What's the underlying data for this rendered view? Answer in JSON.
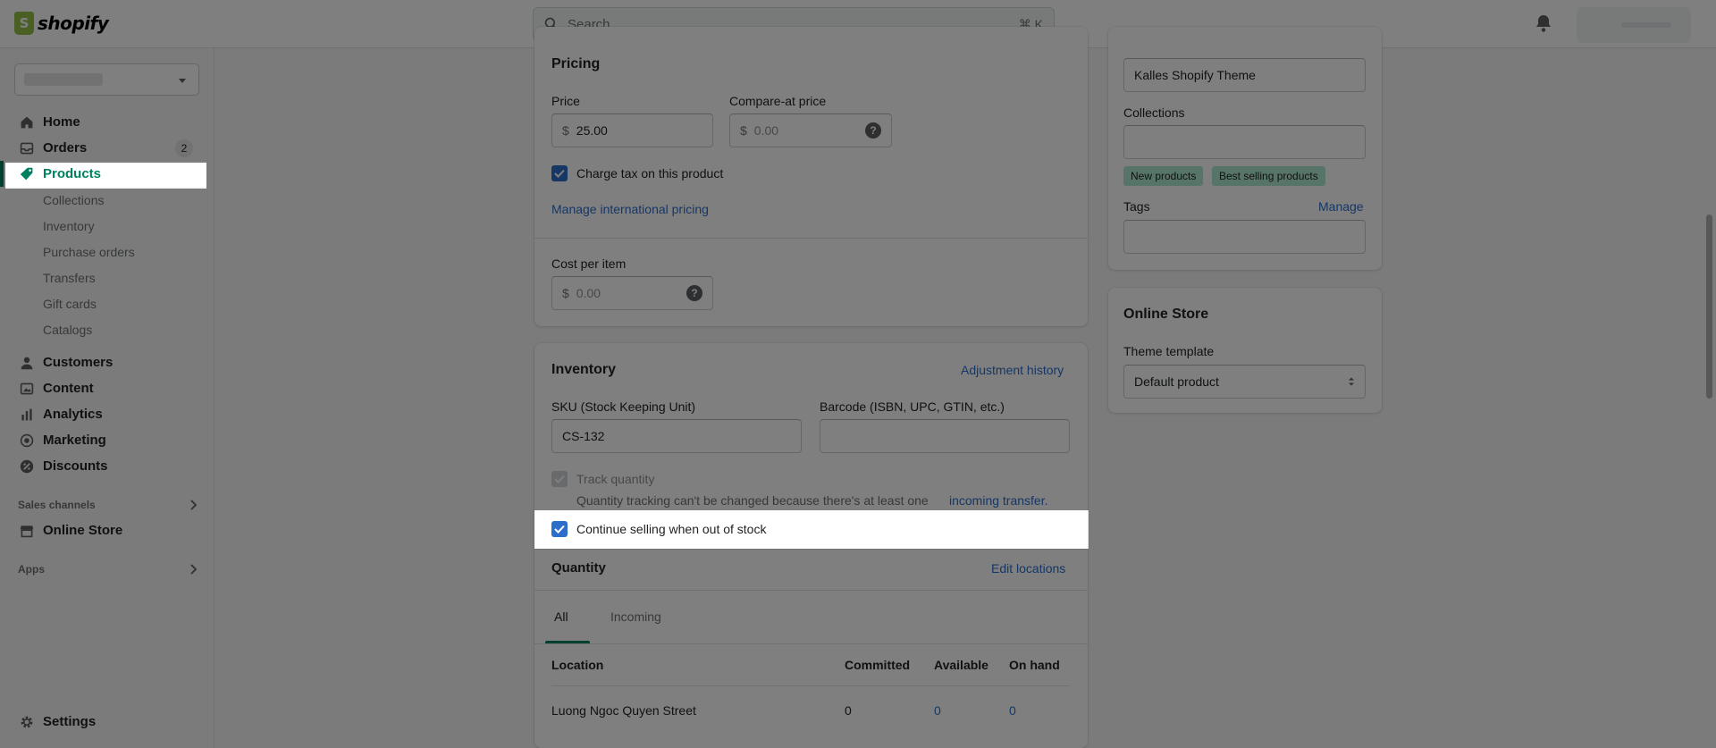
{
  "brand": {
    "name": "shopify"
  },
  "search": {
    "placeholder": "Search",
    "shortcut": "⌘ K"
  },
  "sidebar": {
    "items": [
      {
        "label": "Home",
        "icon": "home-icon"
      },
      {
        "label": "Orders",
        "icon": "orders-icon",
        "badge": "2"
      },
      {
        "label": "Products",
        "icon": "tag-icon",
        "active": true
      }
    ],
    "product_subitems": [
      "Collections",
      "Inventory",
      "Purchase orders",
      "Transfers",
      "Gift cards",
      "Catalogs"
    ],
    "more_items": [
      {
        "label": "Customers",
        "icon": "customers-icon"
      },
      {
        "label": "Content",
        "icon": "content-icon"
      },
      {
        "label": "Analytics",
        "icon": "analytics-icon"
      },
      {
        "label": "Marketing",
        "icon": "marketing-icon"
      },
      {
        "label": "Discounts",
        "icon": "discounts-icon"
      }
    ],
    "sales_channels_label": "Sales channels",
    "online_store": "Online Store",
    "apps_label": "Apps",
    "settings": "Settings"
  },
  "pricing": {
    "title": "Pricing",
    "price_label": "Price",
    "currency": "$",
    "price_value": "25.00",
    "compare_label": "Compare-at price",
    "compare_placeholder": "0.00",
    "charge_tax_label": "Charge tax on this product",
    "charge_tax_checked": true,
    "intl_link": "Manage international pricing",
    "cost_label": "Cost per item",
    "cost_placeholder": "0.00"
  },
  "inventory": {
    "title": "Inventory",
    "history_link": "Adjustment history",
    "sku_label": "SKU (Stock Keeping Unit)",
    "sku_value": "CS-132",
    "barcode_label": "Barcode (ISBN, UPC, GTIN, etc.)",
    "barcode_value": "",
    "track_label": "Track quantity",
    "track_note": "Quantity tracking can't be changed because there's at least one",
    "track_note_link": "incoming transfer.",
    "continue_label": "Continue selling when out of stock",
    "continue_checked": true,
    "quantity_title": "Quantity",
    "edit_locations": "Edit locations",
    "tabs": [
      "All",
      "Incoming"
    ],
    "table": {
      "headers": [
        "Location",
        "Committed",
        "Available",
        "On hand"
      ],
      "rows": [
        {
          "location": "Luong Ngoc Quyen Street",
          "committed": "0",
          "available": "0",
          "on_hand": "0"
        }
      ]
    }
  },
  "organization": {
    "vendor_value": "Kalles Shopify Theme",
    "collections_label": "Collections",
    "collections_value": "",
    "collection_tags": [
      "New products",
      "Best selling products"
    ],
    "tags_label": "Tags",
    "tags_manage": "Manage",
    "tags_value": ""
  },
  "online_store": {
    "title": "Online Store",
    "template_label": "Theme template",
    "template_value": "Default product"
  },
  "colors": {
    "accent": "#008060",
    "link": "#2c6ecb",
    "checkbox": "#2c6ecb",
    "tag": "#aee9d1"
  }
}
